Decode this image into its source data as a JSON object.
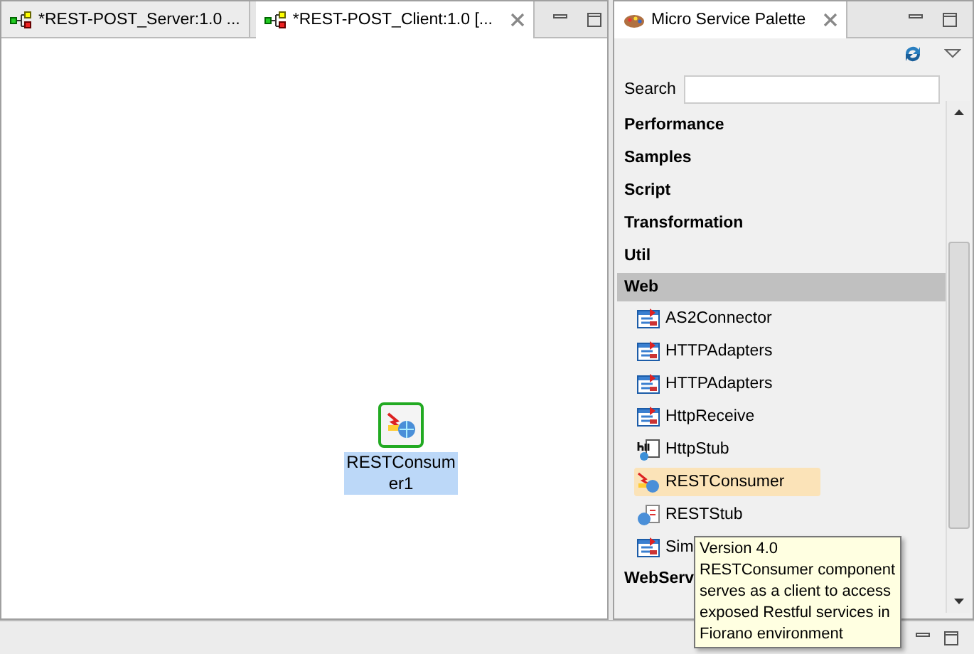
{
  "editor": {
    "tabs": [
      {
        "label": "*REST-POST_Server:1.0 ...",
        "selected": false,
        "closable": false
      },
      {
        "label": "*REST-POST_Client:1.0 [...",
        "selected": true,
        "closable": true
      }
    ],
    "node": {
      "label": "RESTConsumer1",
      "selected": true
    }
  },
  "palette": {
    "title": "Micro Service Palette",
    "search": {
      "label": "Search"
    },
    "categories": [
      {
        "label": "Performance",
        "selected": false
      },
      {
        "label": "Samples",
        "selected": false
      },
      {
        "label": "Script",
        "selected": false
      },
      {
        "label": "Transformation",
        "selected": false
      },
      {
        "label": "Util",
        "selected": false
      },
      {
        "label": "Web",
        "selected": true,
        "items": [
          {
            "label": "AS2Connector",
            "kind": "adapter",
            "selected": false
          },
          {
            "label": "HTTPAdapters",
            "kind": "adapter",
            "selected": false
          },
          {
            "label": "HTTPAdapters",
            "kind": "adapter",
            "selected": false
          },
          {
            "label": "HttpReceive",
            "kind": "adapter",
            "selected": false
          },
          {
            "label": "HttpStub",
            "kind": "stub",
            "selected": false
          },
          {
            "label": "RESTConsumer",
            "kind": "rest",
            "selected": true
          },
          {
            "label": "RESTStub",
            "kind": "reststub",
            "selected": false
          },
          {
            "label": "Sim",
            "kind": "adapter",
            "selected": false
          }
        ]
      },
      {
        "label": "WebServ",
        "selected": false
      }
    ],
    "tooltip": [
      "Version 4.0",
      "RESTConsumer component",
      "serves as a client to access",
      "exposed Restful services in",
      "Fiorano environment"
    ]
  }
}
